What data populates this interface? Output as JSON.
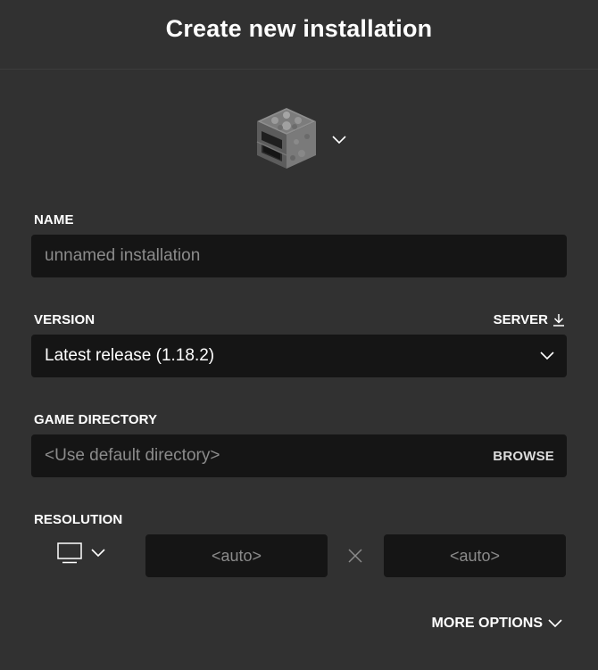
{
  "dialog": {
    "title": "Create new installation"
  },
  "icon": {
    "name": "furnace-icon"
  },
  "name_field": {
    "label": "NAME",
    "placeholder": "unnamed installation"
  },
  "version_field": {
    "label": "VERSION",
    "server_link": "SERVER",
    "selected": "Latest release (1.18.2)"
  },
  "directory_field": {
    "label": "GAME DIRECTORY",
    "placeholder": "<Use default directory>",
    "browse_label": "BROWSE"
  },
  "resolution": {
    "label": "RESOLUTION",
    "width_placeholder": "<auto>",
    "height_placeholder": "<auto>"
  },
  "more_options": {
    "label": "MORE OPTIONS"
  },
  "colors": {
    "background": "#313131",
    "field": "#151515",
    "placeholder": "#8b8b8b",
    "text": "#ffffff"
  }
}
